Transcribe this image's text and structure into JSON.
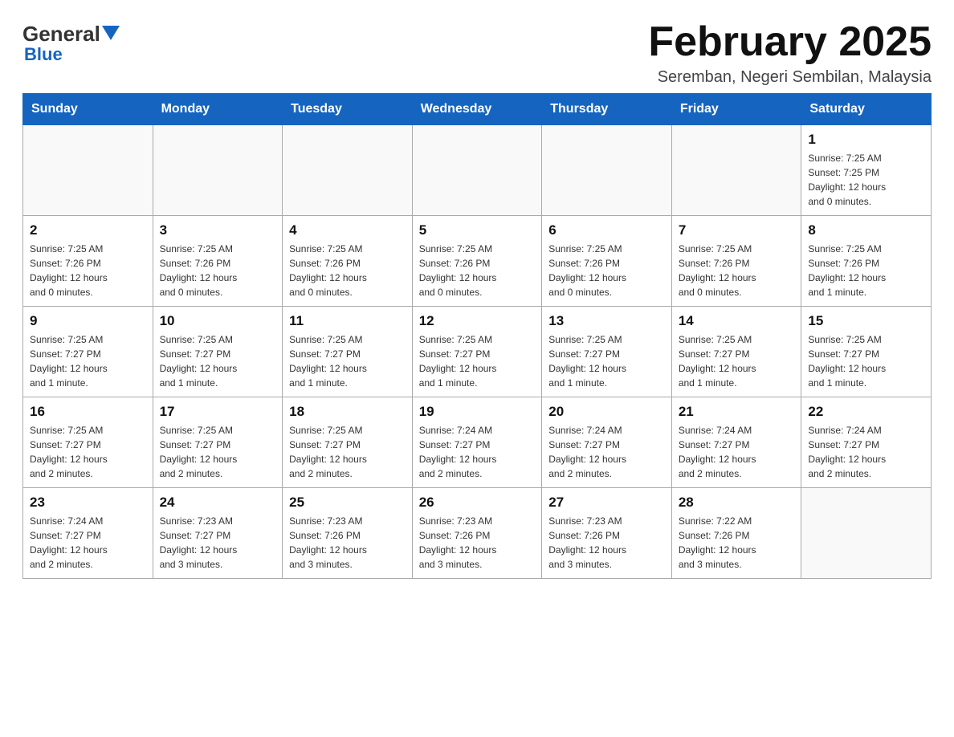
{
  "header": {
    "title": "February 2025",
    "subtitle": "Seremban, Negeri Sembilan, Malaysia",
    "logo_general": "General",
    "logo_blue": "Blue"
  },
  "weekdays": [
    "Sunday",
    "Monday",
    "Tuesday",
    "Wednesday",
    "Thursday",
    "Friday",
    "Saturday"
  ],
  "weeks": [
    [
      {
        "day": "",
        "info": ""
      },
      {
        "day": "",
        "info": ""
      },
      {
        "day": "",
        "info": ""
      },
      {
        "day": "",
        "info": ""
      },
      {
        "day": "",
        "info": ""
      },
      {
        "day": "",
        "info": ""
      },
      {
        "day": "1",
        "info": "Sunrise: 7:25 AM\nSunset: 7:25 PM\nDaylight: 12 hours\nand 0 minutes."
      }
    ],
    [
      {
        "day": "2",
        "info": "Sunrise: 7:25 AM\nSunset: 7:26 PM\nDaylight: 12 hours\nand 0 minutes."
      },
      {
        "day": "3",
        "info": "Sunrise: 7:25 AM\nSunset: 7:26 PM\nDaylight: 12 hours\nand 0 minutes."
      },
      {
        "day": "4",
        "info": "Sunrise: 7:25 AM\nSunset: 7:26 PM\nDaylight: 12 hours\nand 0 minutes."
      },
      {
        "day": "5",
        "info": "Sunrise: 7:25 AM\nSunset: 7:26 PM\nDaylight: 12 hours\nand 0 minutes."
      },
      {
        "day": "6",
        "info": "Sunrise: 7:25 AM\nSunset: 7:26 PM\nDaylight: 12 hours\nand 0 minutes."
      },
      {
        "day": "7",
        "info": "Sunrise: 7:25 AM\nSunset: 7:26 PM\nDaylight: 12 hours\nand 0 minutes."
      },
      {
        "day": "8",
        "info": "Sunrise: 7:25 AM\nSunset: 7:26 PM\nDaylight: 12 hours\nand 1 minute."
      }
    ],
    [
      {
        "day": "9",
        "info": "Sunrise: 7:25 AM\nSunset: 7:27 PM\nDaylight: 12 hours\nand 1 minute."
      },
      {
        "day": "10",
        "info": "Sunrise: 7:25 AM\nSunset: 7:27 PM\nDaylight: 12 hours\nand 1 minute."
      },
      {
        "day": "11",
        "info": "Sunrise: 7:25 AM\nSunset: 7:27 PM\nDaylight: 12 hours\nand 1 minute."
      },
      {
        "day": "12",
        "info": "Sunrise: 7:25 AM\nSunset: 7:27 PM\nDaylight: 12 hours\nand 1 minute."
      },
      {
        "day": "13",
        "info": "Sunrise: 7:25 AM\nSunset: 7:27 PM\nDaylight: 12 hours\nand 1 minute."
      },
      {
        "day": "14",
        "info": "Sunrise: 7:25 AM\nSunset: 7:27 PM\nDaylight: 12 hours\nand 1 minute."
      },
      {
        "day": "15",
        "info": "Sunrise: 7:25 AM\nSunset: 7:27 PM\nDaylight: 12 hours\nand 1 minute."
      }
    ],
    [
      {
        "day": "16",
        "info": "Sunrise: 7:25 AM\nSunset: 7:27 PM\nDaylight: 12 hours\nand 2 minutes."
      },
      {
        "day": "17",
        "info": "Sunrise: 7:25 AM\nSunset: 7:27 PM\nDaylight: 12 hours\nand 2 minutes."
      },
      {
        "day": "18",
        "info": "Sunrise: 7:25 AM\nSunset: 7:27 PM\nDaylight: 12 hours\nand 2 minutes."
      },
      {
        "day": "19",
        "info": "Sunrise: 7:24 AM\nSunset: 7:27 PM\nDaylight: 12 hours\nand 2 minutes."
      },
      {
        "day": "20",
        "info": "Sunrise: 7:24 AM\nSunset: 7:27 PM\nDaylight: 12 hours\nand 2 minutes."
      },
      {
        "day": "21",
        "info": "Sunrise: 7:24 AM\nSunset: 7:27 PM\nDaylight: 12 hours\nand 2 minutes."
      },
      {
        "day": "22",
        "info": "Sunrise: 7:24 AM\nSunset: 7:27 PM\nDaylight: 12 hours\nand 2 minutes."
      }
    ],
    [
      {
        "day": "23",
        "info": "Sunrise: 7:24 AM\nSunset: 7:27 PM\nDaylight: 12 hours\nand 2 minutes."
      },
      {
        "day": "24",
        "info": "Sunrise: 7:23 AM\nSunset: 7:27 PM\nDaylight: 12 hours\nand 3 minutes."
      },
      {
        "day": "25",
        "info": "Sunrise: 7:23 AM\nSunset: 7:26 PM\nDaylight: 12 hours\nand 3 minutes."
      },
      {
        "day": "26",
        "info": "Sunrise: 7:23 AM\nSunset: 7:26 PM\nDaylight: 12 hours\nand 3 minutes."
      },
      {
        "day": "27",
        "info": "Sunrise: 7:23 AM\nSunset: 7:26 PM\nDaylight: 12 hours\nand 3 minutes."
      },
      {
        "day": "28",
        "info": "Sunrise: 7:22 AM\nSunset: 7:26 PM\nDaylight: 12 hours\nand 3 minutes."
      },
      {
        "day": "",
        "info": ""
      }
    ]
  ]
}
